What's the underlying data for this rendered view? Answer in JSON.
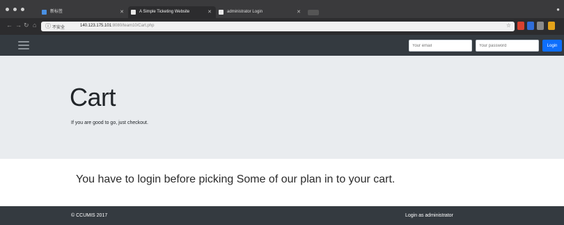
{
  "browser": {
    "tabs": [
      {
        "label": "新标签"
      },
      {
        "label": "A Simple Ticketing Website"
      },
      {
        "label": "administrator Login"
      }
    ],
    "address": {
      "secure_label": "不安全",
      "url_host": "140.123.175.101",
      "url_path": ":8080/team10/Cart.php"
    }
  },
  "navbar": {
    "email_placeholder": "Your email",
    "password_placeholder": "Your password",
    "login_label": "Login"
  },
  "jumbotron": {
    "title": "Cart",
    "lead": "If you are good to go, just checkout."
  },
  "main": {
    "message": "You have to login before picking Some of our plan in to your cart."
  },
  "footer": {
    "copyright": "© CCUMIS 2017",
    "admin_link": "Login as administrator"
  },
  "colors": {
    "navbar_bg": "#343a40",
    "jumbotron_bg": "#e9ecef",
    "login_button": "#0d6efd"
  },
  "icons": [
    "menu-icon",
    "back-icon",
    "forward-icon",
    "reload-icon",
    "home-icon",
    "info-icon",
    "star-icon",
    "tab-close-icon"
  ]
}
